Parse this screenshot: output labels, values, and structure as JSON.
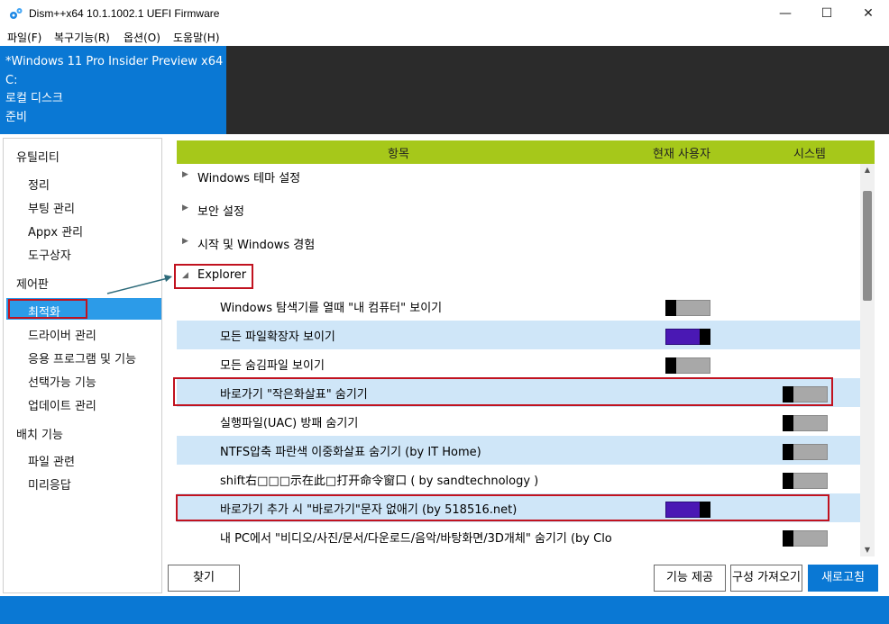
{
  "window": {
    "title": "Dism++x64 10.1.1002.1 UEFI Firmware",
    "minimize_glyph": "—",
    "maximize_glyph": "☐",
    "close_glyph": "✕"
  },
  "menu": [
    "파일(F)",
    "복구기능(R)",
    "옵션(O)",
    "도움말(H)"
  ],
  "info": {
    "os": "*Windows 11 Pro Insider Preview x64",
    "drive": "C:",
    "disk": "로컬 디스크",
    "status": "준비"
  },
  "nav": {
    "groups": [
      "유틸리티",
      "제어판",
      "배치 기능"
    ],
    "utilities": [
      "정리",
      "부팅 관리",
      "Appx 관리",
      "도구상자"
    ],
    "control_panel": [
      "최적화",
      "드라이버 관리",
      "응용 프로그램 및 기능",
      "선택가능 기능",
      "업데이트 관리"
    ],
    "deploy": [
      "파일 관련",
      "미리응답"
    ]
  },
  "table": {
    "headers": [
      "항목",
      "현재 사용자",
      "시스템"
    ],
    "categories": [
      "Windows 테마 설정",
      "보안 설정",
      "시작 및 Windows 경험",
      "Explorer"
    ],
    "options": [
      {
        "label": "Windows 탐색기를 열때 \"내 컴퓨터\" 보이기",
        "column": "user",
        "state": "off"
      },
      {
        "label": "모든 파일확장자 보이기",
        "column": "user",
        "state": "on"
      },
      {
        "label": "모든 숨김파일 보이기",
        "column": "user",
        "state": "off"
      },
      {
        "label": "바로가기 \"작은화살표\" 숨기기",
        "column": "system",
        "state": "off"
      },
      {
        "label": "실행파일(UAC) 방패 숨기기",
        "column": "system",
        "state": "off"
      },
      {
        "label": "NTFS압축 파란색 이중화살표 숨기기 (by IT Home)",
        "column": "system",
        "state": "off"
      },
      {
        "label": "shift右□□□示在此□打开命令窗口 ( by sandtechnology )",
        "column": "system",
        "state": "off"
      },
      {
        "label": "바로가기 추가 시 \"바로가기\"문자 없애기 (by 518516.net)",
        "column": "user",
        "state": "on"
      },
      {
        "label": "내 PC에서 \"비디오/사진/문서/다운로드/음악/바탕화면/3D개체\" 숨기기 (by Clo",
        "column": "system",
        "state": "off"
      }
    ]
  },
  "buttons": {
    "find": "찾기",
    "features": "기능 제공",
    "config": "구성 가져오기",
    "refresh": "새로고침"
  },
  "colors": {
    "accent": "#0a78d4",
    "header_green": "#a6c81a",
    "toggle_on": "#4a18b4",
    "highlight_red": "#c1121f",
    "row_alt": "#cfe6f8"
  }
}
